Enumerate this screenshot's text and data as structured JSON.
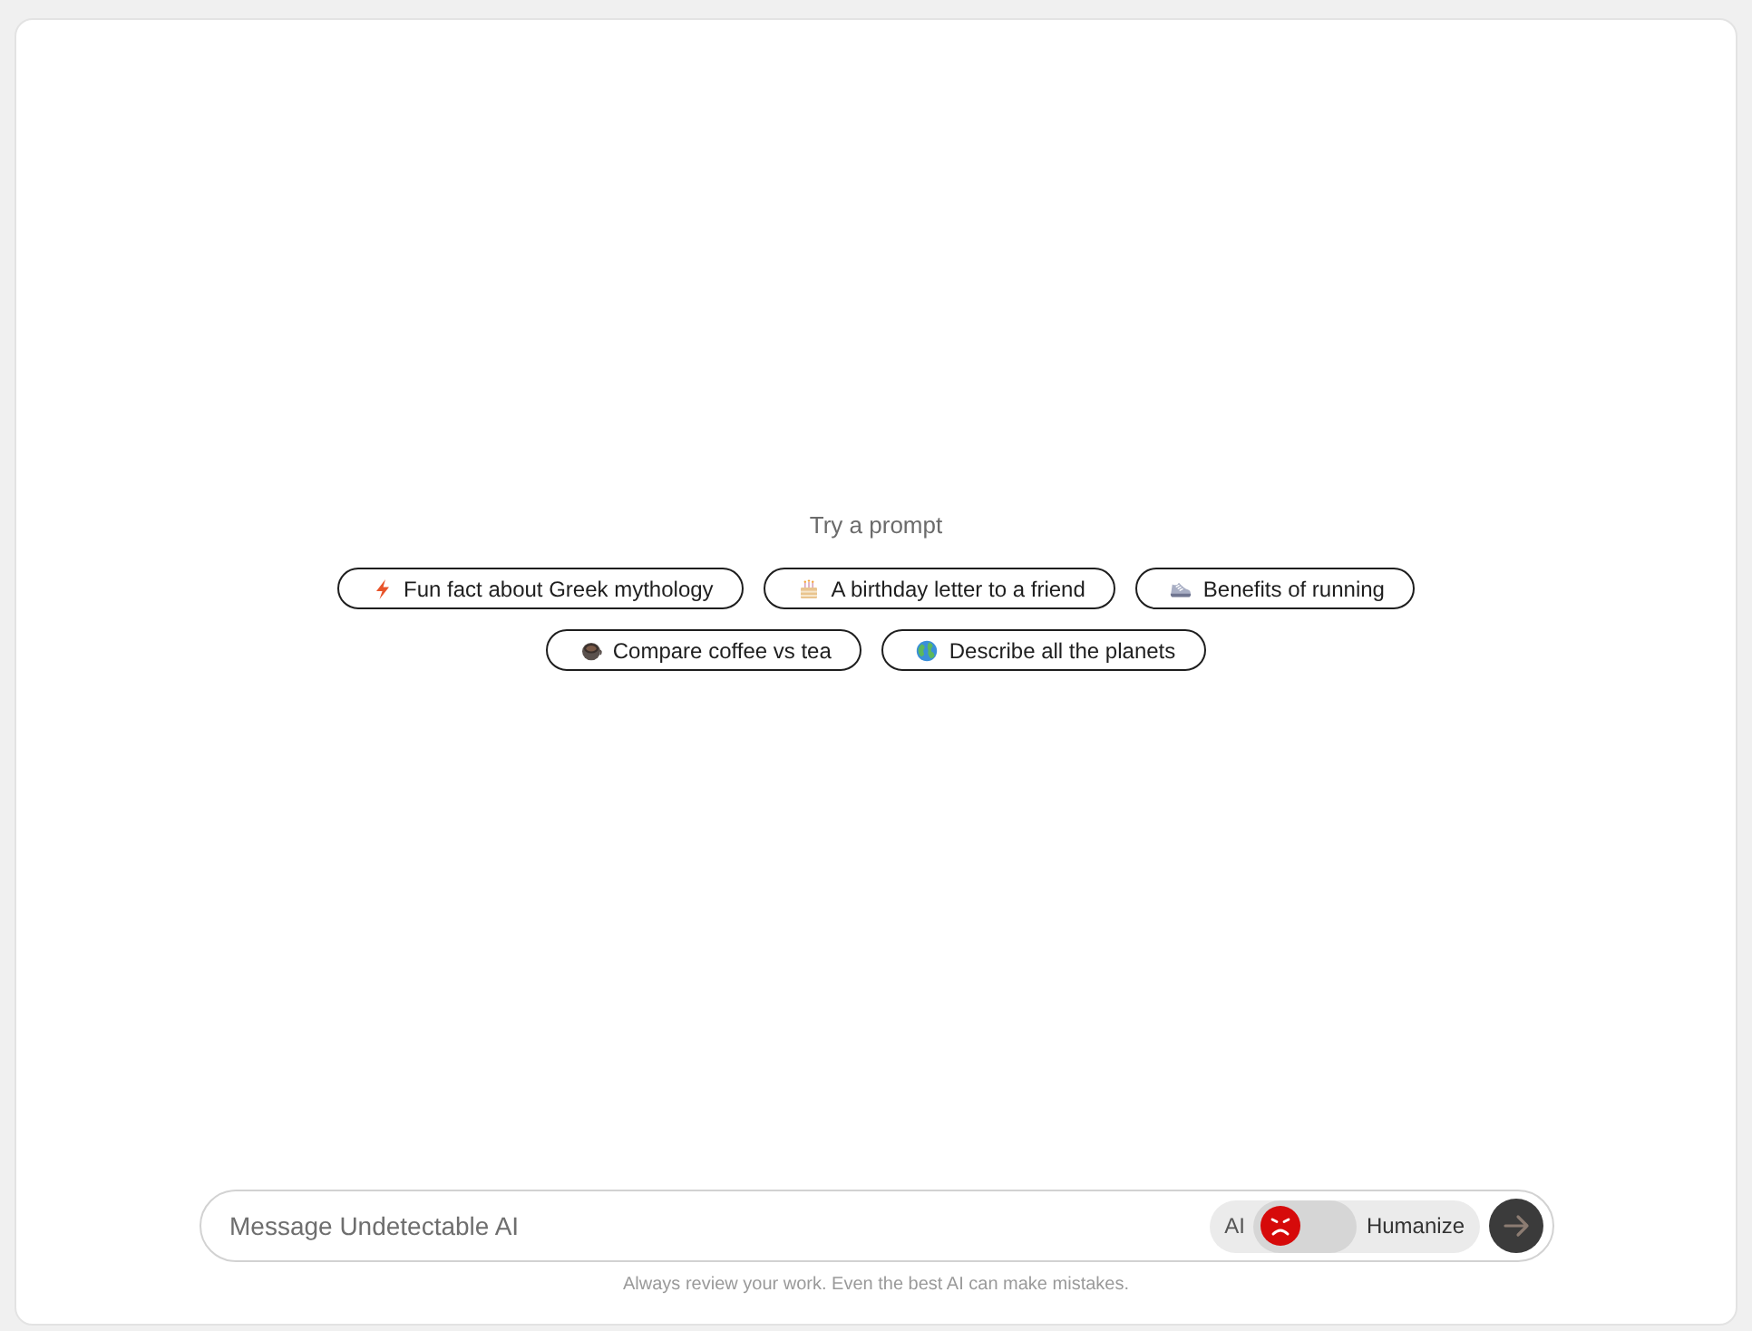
{
  "prompt_section": {
    "title": "Try a prompt",
    "prompts": [
      {
        "label": "Fun fact about Greek mythology"
      },
      {
        "label": "A birthday letter to a friend"
      },
      {
        "label": "Benefits of running"
      },
      {
        "label": "Compare coffee vs tea"
      },
      {
        "label": "Describe all the planets"
      }
    ]
  },
  "composer": {
    "placeholder": "Message Undetectable AI",
    "mode_switch": {
      "left_label": "AI",
      "right_label": "Humanize",
      "on": false
    }
  },
  "disclaimer": "Always review your work. Even the best AI can make mistakes."
}
